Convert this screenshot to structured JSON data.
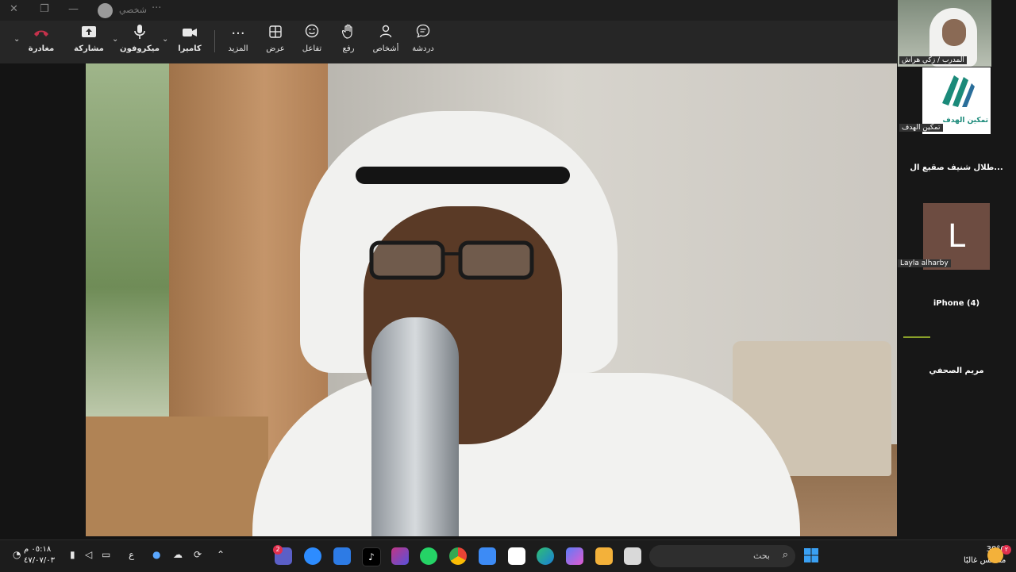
{
  "titlebar": {
    "close": "✕",
    "minimize": "—",
    "restore": "❐",
    "profile_name": "شخصي",
    "more": "···"
  },
  "toolbar": {
    "chat": {
      "label": "دردشة",
      "icon": "chat-icon"
    },
    "people": {
      "label": "أشخاص",
      "icon": "people-icon"
    },
    "raise": {
      "label": "رفع",
      "icon": "hand-icon"
    },
    "react": {
      "label": "تفاعل",
      "icon": "smile-icon"
    },
    "view": {
      "label": "عرض",
      "icon": "grid-icon"
    },
    "more": {
      "label": "المزيد",
      "icon": "more-icon"
    },
    "camera": {
      "label": "كاميرا",
      "icon": "camera-icon"
    },
    "mic": {
      "label": "ميكروفون",
      "icon": "mic-icon"
    },
    "share": {
      "label": "مشاركة",
      "icon": "share-icon"
    },
    "leave": {
      "label": "مغادرة",
      "icon": "phone-hangup-icon"
    }
  },
  "participants": [
    {
      "name": "المدرب / زكي هراش"
    },
    {
      "name": "تمكين الهدف",
      "logo_text": "تمكين الهدف"
    },
    {
      "name": "طلال شنيف صقيع ال..."
    },
    {
      "name": "Layla alharby",
      "initial": "L"
    },
    {
      "name": "iPhone (4)"
    },
    {
      "name": "مريم الصحفي"
    }
  ],
  "taskbar": {
    "search_placeholder": "بحث",
    "weather_temp": "30°C",
    "weather_desc": "مشمس غالبًا",
    "weather_badge": "٢",
    "clock_time": "٠٥:١٨ م",
    "clock_date": "٤٧/٠٧/٠٣",
    "lang": "ع",
    "teams_badge": "2"
  },
  "colors": {
    "leave_red": "#c4314b",
    "panel_bg": "#262626",
    "tile_brown": "#6d4c41",
    "logo_teal": "#1b8a7a"
  }
}
